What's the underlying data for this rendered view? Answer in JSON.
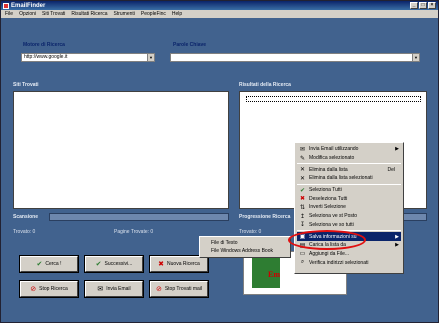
{
  "window": {
    "title": "EmailFinder",
    "buttons": [
      "_",
      "□",
      "×"
    ]
  },
  "menu": [
    "File",
    "Opzioni",
    "Siti Trovati",
    "Risultati Ricerca",
    "Strumenti",
    "PeopleFinc",
    "Help"
  ],
  "search": {
    "search_label": "Motore di Ricerca",
    "search_value": "http://www.google.it",
    "keyword_label": "Parole Chiave",
    "keyword_value": ""
  },
  "panels": {
    "sites_label": "Siti Trovati",
    "results_label": "Risultati della Ricerca",
    "scan_label": "Scansione",
    "progress_label": "Progressione Ricerca",
    "found_label": "Trovato: 0",
    "pages_found_label": "Pagine Trovate: 0",
    "found_right_label": "Trovato: 0"
  },
  "buttons": {
    "cerca": "Cerca !",
    "successivi": "Successivi...",
    "nuova": "Nuova Ricerca",
    "stop": "Stop Ricerca",
    "invia": "Invia Email",
    "stop_trovati": "Stop Trovati mail"
  },
  "submenu": [
    "File di Testo",
    "File Windows Address Book"
  ],
  "context_menu": [
    {
      "label": "Invia Email utilizzando",
      "icon": "envelope-icon",
      "arrow": true
    },
    {
      "label": "Modifica selezionato",
      "icon": "edit-icon"
    },
    {
      "label": "Elimina dalla lista",
      "icon": "delete-x-icon",
      "shortcut": "Del"
    },
    {
      "label": "Elimina dalla lista selezionati",
      "icon": "delete-x-icon"
    },
    {
      "label": "Seleziona Tutti",
      "icon": "check-icon"
    },
    {
      "label": "Deseleziona Tutti",
      "icon": "uncheck-icon"
    },
    {
      "label": "Inverti Selezione",
      "icon": "invert-icon"
    },
    {
      "label": "Seleziona ve st Posto",
      "icon": "select-icon"
    },
    {
      "label": "Seleziona ve so tutti",
      "icon": "select-icon"
    },
    {
      "label": "Salva informazioni su",
      "icon": "save-icon",
      "arrow": true,
      "highlighted": true
    },
    {
      "label": "Carica la lista da",
      "icon": "load-icon",
      "arrow": true
    },
    {
      "label": "Aggiungi da File...",
      "icon": "folder-icon"
    },
    {
      "label": "Verifica indirizzi selezionati",
      "icon": "magnifier-icon"
    }
  ],
  "colors": {
    "background": "#41628e",
    "highlight": "#0a246a",
    "ring": "#e01010"
  }
}
